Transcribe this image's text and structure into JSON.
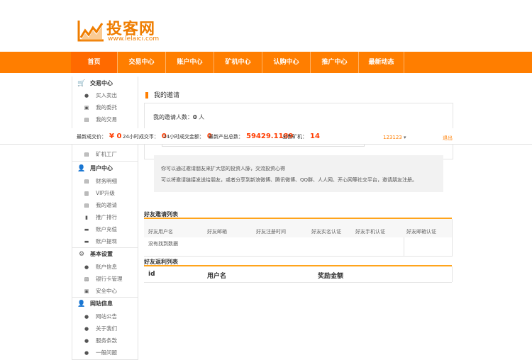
{
  "logo": {
    "title": "投客网",
    "url": "www.lelaici.com"
  },
  "nav": [
    "首页",
    "交易中心",
    "账户中心",
    "矿机中心",
    "认购中心",
    "推广中心",
    "最新动态"
  ],
  "sidebar": {
    "trade": {
      "title": "交易中心",
      "items": [
        "买入卖出",
        "我的委托",
        "我的交易"
      ]
    },
    "miner_item": "矿机工厂",
    "user": {
      "title": "用户中心",
      "items": [
        "财务明细",
        "VIP升级",
        "我的邀请",
        "推广排行",
        "账户充值",
        "账户提现"
      ]
    },
    "settings": {
      "title": "基本设置",
      "items": [
        "账户信息",
        "银行卡管理",
        "安全中心"
      ]
    },
    "info": {
      "title": "网站信息",
      "items": [
        "网站公告",
        "关于我们",
        "服务条款",
        "一般问题"
      ]
    }
  },
  "main": {
    "title": "我的邀请",
    "invite_label": "我的邀请人数：",
    "invite_count": "0",
    "invite_unit": "人",
    "tip1": "你可以通过邀请朋友来扩大您的投资人脉，交流投资心得",
    "tip2": "可以将邀请链接发送给朋友，或者分享到新浪微博、腾讯微博、QQ群、人人网、开心网等社交平台，邀请朋友注册。"
  },
  "ticker": {
    "price_label": "最新成交价：",
    "price": "¥ 0",
    "volume_label": "24小时成交币：",
    "volume": "0",
    "amount_label": "24小时成交金额：",
    "amount": "0",
    "output_label": "最新产出总数：",
    "output": "59429.1189",
    "miners_label": "出售矿机：",
    "miners": "14",
    "user": "123123",
    "logout": "退出"
  },
  "friends_table": {
    "title": "好友邀请列表",
    "headers": [
      "好友用户名",
      "好友邮箱",
      "好友注册时间",
      "好友实名认证",
      "好友手机认证",
      "好友邮箱认证"
    ],
    "empty": "没有找到数据"
  },
  "rebate_table": {
    "title": "好友返利列表",
    "headers": [
      "id",
      "用户名",
      "奖励金额"
    ]
  }
}
